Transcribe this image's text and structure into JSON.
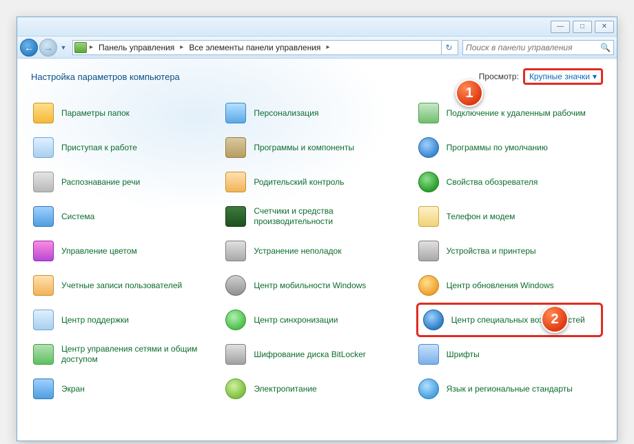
{
  "window": {
    "minimize": "—",
    "maximize": "□",
    "close": "✕"
  },
  "nav": {
    "back_glyph": "←",
    "fwd_glyph": "→",
    "dropdown_glyph": "▼",
    "refresh_glyph": "↻"
  },
  "breadcrumbs": {
    "icon_name": "control-panel-icon",
    "items": [
      "Панель управления",
      "Все элементы панели управления"
    ],
    "arrow": "▸"
  },
  "search": {
    "placeholder": "Поиск в панели управления",
    "icon_glyph": "🔍"
  },
  "header": {
    "title": "Настройка параметров компьютера",
    "view_label": "Просмотр:",
    "view_value": "Крупные значки",
    "view_arrow": "▾"
  },
  "items": [
    {
      "label": "Параметры папок",
      "icon": "ic-folder",
      "name": "folder-options"
    },
    {
      "label": "Персонализация",
      "icon": "ic-screen",
      "name": "personalization"
    },
    {
      "label": "Подключение к удаленным рабочим",
      "icon": "ic-screen2",
      "name": "remote-desktop"
    },
    {
      "label": "Приступая к работе",
      "icon": "ic-flag",
      "name": "getting-started"
    },
    {
      "label": "Программы и компоненты",
      "icon": "ic-box",
      "name": "programs-features"
    },
    {
      "label": "Программы по умолчанию",
      "icon": "ic-gear",
      "name": "default-programs"
    },
    {
      "label": "Распознавание речи",
      "icon": "ic-mic",
      "name": "speech-recognition"
    },
    {
      "label": "Родительский контроль",
      "icon": "ic-people",
      "name": "parental-controls"
    },
    {
      "label": "Свойства обозревателя",
      "icon": "ic-globe",
      "name": "internet-options"
    },
    {
      "label": "Система",
      "icon": "ic-monitor",
      "name": "system"
    },
    {
      "label": "Счетчики и средства производительности",
      "icon": "ic-monitor2",
      "name": "performance-tools"
    },
    {
      "label": "Телефон и модем",
      "icon": "ic-phone",
      "name": "phone-modem"
    },
    {
      "label": "Управление цветом",
      "icon": "ic-color",
      "name": "color-management"
    },
    {
      "label": "Устранение неполадок",
      "icon": "ic-wrench",
      "name": "troubleshooting"
    },
    {
      "label": "Устройства и принтеры",
      "icon": "ic-printer",
      "name": "devices-printers"
    },
    {
      "label": "Учетные записи пользователей",
      "icon": "ic-users",
      "name": "user-accounts"
    },
    {
      "label": "Центр мобильности Windows",
      "icon": "ic-disc",
      "name": "mobility-center"
    },
    {
      "label": "Центр обновления Windows",
      "icon": "ic-update",
      "name": "windows-update"
    },
    {
      "label": "Центр поддержки",
      "icon": "ic-flag",
      "name": "action-center"
    },
    {
      "label": "Центр синхронизации",
      "icon": "ic-sync",
      "name": "sync-center"
    },
    {
      "label": "Центр специальных возможностей",
      "icon": "ic-blue",
      "name": "ease-of-access",
      "highlighted": true
    },
    {
      "label": "Центр управления сетями и общим доступом",
      "icon": "ic-net",
      "name": "network-sharing"
    },
    {
      "label": "Шифрование диска BitLocker",
      "icon": "ic-lock",
      "name": "bitlocker"
    },
    {
      "label": "Шрифты",
      "icon": "ic-font",
      "name": "fonts"
    },
    {
      "label": "Экран",
      "icon": "ic-monitor",
      "name": "display"
    },
    {
      "label": "Электропитание",
      "icon": "ic-power",
      "name": "power-options"
    },
    {
      "label": "Язык и региональные стандарты",
      "icon": "ic-lang",
      "name": "region-language"
    }
  ],
  "annotations": {
    "badge1": "1",
    "badge2": "2"
  }
}
